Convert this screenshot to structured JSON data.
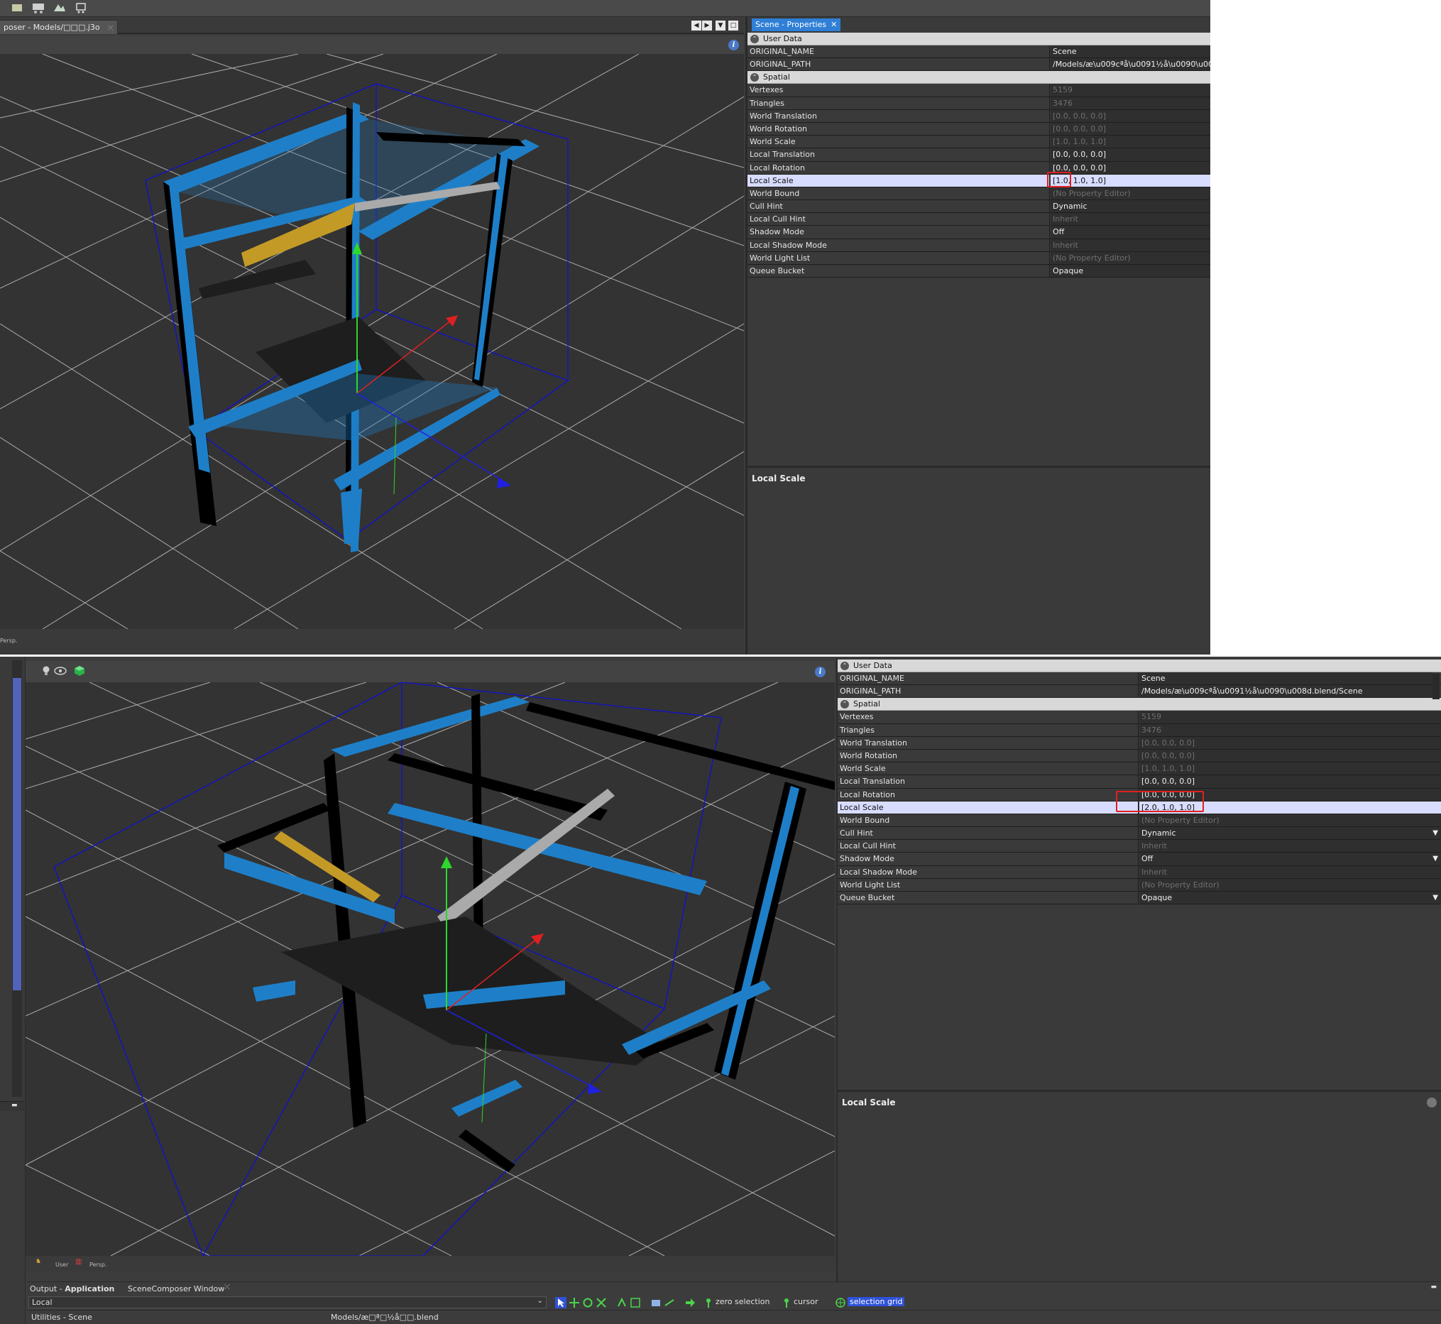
{
  "top": {
    "doc_tab": "poser - Models/□□□.j3o",
    "props_tab": "Scene - Properties",
    "props_tab_close": "✕",
    "info": "i",
    "vp_mode": "Persp.",
    "sections": {
      "user_data": "User Data",
      "spatial": "Spatial"
    },
    "user_data_rows": [
      {
        "key": "ORIGINAL_NAME",
        "value": "Scene"
      },
      {
        "key": "ORIGINAL_PATH",
        "value": "/Models/æ\\u009cªå\\u0091½å\\u0090\\u00"
      }
    ],
    "spatial_rows": [
      {
        "key": "Vertexes",
        "value": "5159"
      },
      {
        "key": "Triangles",
        "value": "3476"
      },
      {
        "key": "World Translation",
        "value": "[0.0, 0.0, 0.0]"
      },
      {
        "key": "World Rotation",
        "value": "[0.0, 0.0, 0.0]"
      },
      {
        "key": "World Scale",
        "value": "[1.0, 1.0, 1.0]"
      },
      {
        "key": "Local Translation",
        "value": "[0.0, 0.0, 0.0]"
      },
      {
        "key": "Local Rotation",
        "value": "[0.0, 0.0, 0.0]"
      },
      {
        "key": "Local Scale",
        "value": "[1.0, 1.0, 1.0]"
      },
      {
        "key": "World Bound",
        "value": "(No Property Editor)"
      },
      {
        "key": "Cull Hint",
        "value": "Dynamic"
      },
      {
        "key": "Local Cull Hint",
        "value": "Inherit"
      },
      {
        "key": "Shadow Mode",
        "value": "Off"
      },
      {
        "key": "Local Shadow Mode",
        "value": "Inherit"
      },
      {
        "key": "World Light List",
        "value": "(No Property Editor)"
      },
      {
        "key": "Queue Bucket",
        "value": "Opaque"
      }
    ],
    "description_title": "Local Scale"
  },
  "bottom": {
    "info": "i",
    "vp_user": "User",
    "vp_mode": "Persp.",
    "sections": {
      "user_data": "User Data",
      "spatial": "Spatial"
    },
    "user_data_rows": [
      {
        "key": "ORIGINAL_NAME",
        "value": "Scene"
      },
      {
        "key": "ORIGINAL_PATH",
        "value": "/Models/æ\\u009cªå\\u0091½å\\u0090\\u008d.blend/Scene"
      }
    ],
    "spatial_rows": [
      {
        "key": "Vertexes",
        "value": "5159"
      },
      {
        "key": "Triangles",
        "value": "3476"
      },
      {
        "key": "World Translation",
        "value": "[0.0, 0.0, 0.0]"
      },
      {
        "key": "World Rotation",
        "value": "[0.0, 0.0, 0.0]"
      },
      {
        "key": "World Scale",
        "value": "[1.0, 1.0, 1.0]"
      },
      {
        "key": "Local Translation",
        "value": "[0.0, 0.0, 0.0]"
      },
      {
        "key": "Local Rotation",
        "value": "[0.0, 0.0, 0.0]"
      },
      {
        "key": "Local Scale",
        "value": "[2.0, 1.0, 1.0]"
      },
      {
        "key": "World Bound",
        "value": "(No Property Editor)"
      },
      {
        "key": "Cull Hint",
        "value": "Dynamic"
      },
      {
        "key": "Local Cull Hint",
        "value": "Inherit"
      },
      {
        "key": "Shadow Mode",
        "value": "Off"
      },
      {
        "key": "Local Shadow Mode",
        "value": "Inherit"
      },
      {
        "key": "World Light List",
        "value": "(No Property Editor)"
      },
      {
        "key": "Queue Bucket",
        "value": "Opaque"
      }
    ],
    "description_title": "Local Scale",
    "output_tab_prefix": "Output - ",
    "output_tab_bold": "Application",
    "scene_composer_tab": "SceneComposer Window",
    "local_combo": "Local",
    "zero_selection": "zero selection",
    "cursor": "cursor",
    "selection_grid": "selection grid",
    "utilities_scene": "Utilities - Scene",
    "model_path": "Models/æ□ª□½å□□.blend"
  }
}
